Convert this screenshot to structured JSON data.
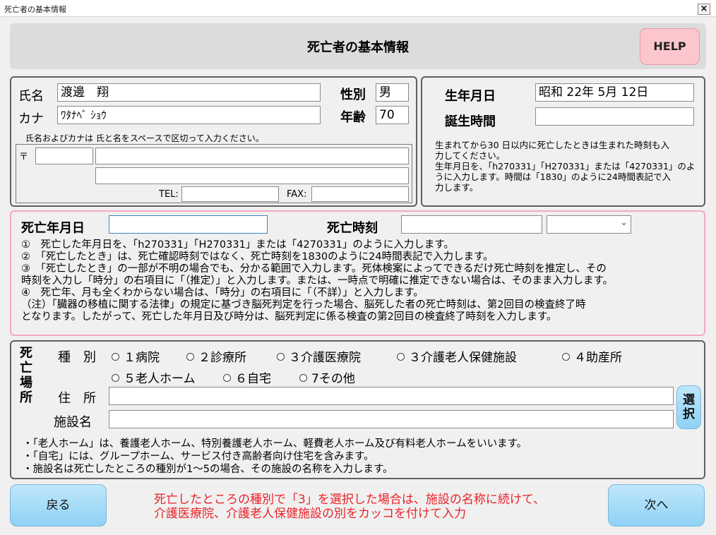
{
  "window": {
    "title": "死亡者の基本情報",
    "close_glyph": "×"
  },
  "header": {
    "title": "死亡者の基本情報",
    "help_label": "HELP"
  },
  "person": {
    "name_label": "氏名",
    "name_value": "渡邊　翔",
    "kana_label": "カナ",
    "kana_value": "ﾜﾀﾅﾍﾞ ｼｮｳ",
    "sex_label": "性別",
    "sex_value": "男",
    "age_label": "年齢",
    "age_value": "70",
    "name_hint": "氏名およびカナは 氏と名をスペースで区切って入力ください。",
    "postal_mark": "〒",
    "postal_value": "",
    "address1_value": "",
    "address2_value": "",
    "tel_label": "TEL:",
    "tel_value": "",
    "fax_label": "FAX:",
    "fax_value": ""
  },
  "birth": {
    "date_label": "生年月日",
    "date_value": "昭和 22年 5月 12日",
    "time_label": "誕生時間",
    "time_value": "",
    "notes": [
      "生まれてから30 日以内に死亡したときは生まれた時刻も入",
      "力してください。",
      "生年月日を、「h270331」「H270331」または「4270331」のよ",
      "うに入力します。時間は「1830」のように24時間表記で入",
      "力します。"
    ]
  },
  "death": {
    "date_label": "死亡年月日",
    "date_value": "",
    "time_label": "死亡時刻",
    "time_value": "",
    "time_select_value": "",
    "dropdown_glyph": "⌄",
    "notes": [
      "①　死亡した年月日を、「h270331」「H270331」または「4270331」のように入力します。",
      "②　「死亡したとき」は、死亡確認時刻ではなく、死亡時刻を1830のように24時間表記で入力します。",
      "③　「死亡したとき」の一部が不明の場合でも、分かる範囲で入力します。死体検案によってできるだけ死亡時刻を推定し、その",
      "時刻を入力し「時分」の右項目に「（推定）」と入力します。または、一時点で明確に推定できない場合は、そのまま入力します。",
      "④　死亡年、月も全くわからない場合は、「時分」の右項目に「（不詳）」と入力します。",
      "（注）「臓器の移植に関する法律」の規定に基づき脳死判定を行った場合、脳死した者の死亡時刻は、第2回目の検査終了時",
      "となります。したがって、死亡した年月日及び時分は、脳死判定に係る検査の第2回目の検査終了時刻を入力します。"
    ]
  },
  "place": {
    "section_label": [
      "死",
      "亡",
      "場",
      "所"
    ],
    "kind_label": "種　別",
    "options": [
      "１病院",
      "２診療所",
      "３介護医療院",
      "３介護老人保健施設",
      "４助産所",
      "５老人ホーム",
      "６自宅",
      "7その他"
    ],
    "address_label": "住　所",
    "address_value": "",
    "facility_label": "施設名",
    "facility_value": "",
    "select_button": [
      "選",
      "択"
    ],
    "notes": [
      "・「老人ホーム」は、養護老人ホーム、特別養護老人ホーム、軽費老人ホーム及び有料老人ホームをいいます。",
      "・「自宅」には、グループホーム、サービス付き高齢者向け住宅を含みます。",
      "・施設名は死亡したところの種別が1～5の場合、その施設の名称を入力します。"
    ]
  },
  "footer": {
    "back_label": "戻る",
    "next_label": "次へ",
    "warning": [
      "死亡したところの種別で「3」を選択した場合は、施設の名称に続けて、",
      "介護医療院、介護老人保健施設の別をカッコを付けて入力"
    ],
    "colors": {
      "warning": "#e8232a",
      "button": "#a8dcf7",
      "help": "#fbc6cc"
    }
  }
}
